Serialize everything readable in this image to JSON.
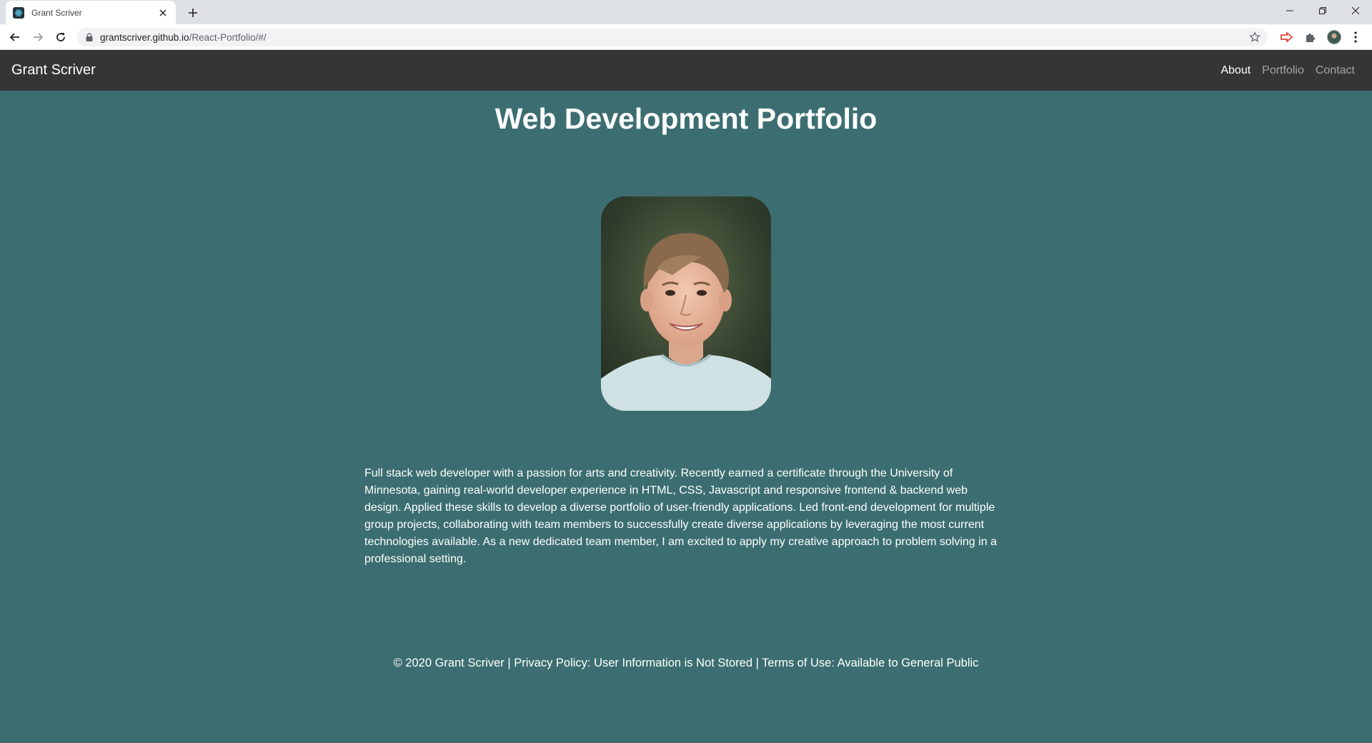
{
  "browser": {
    "tab_title": "Grant Scriver",
    "url_host": "grantscriver.github.io",
    "url_path": "/React-Portfolio/#/"
  },
  "site": {
    "brand": "Grant Scriver",
    "nav": [
      {
        "label": "About",
        "active": true
      },
      {
        "label": "Portfolio",
        "active": false
      },
      {
        "label": "Contact",
        "active": false
      }
    ],
    "title": "Web Development Portfolio",
    "bio": "Full stack web developer with a passion for arts and creativity. Recently earned a certificate through the University of Minnesota, gaining real-world developer experience in HTML, CSS, Javascript and responsive frontend & backend web design. Applied these skills to develop a diverse portfolio of user-friendly applications. Led front-end development for multiple group projects, collaborating with team members to successfully create diverse applications by leveraging the most current technologies available. As a new dedicated team member, I am excited to apply my creative approach to problem solving in a professional setting.",
    "footer": "© 2020 Grant Scriver | Privacy Policy: User Information is Not Stored | Terms of Use: Available to General Public"
  },
  "colors": {
    "navbar": "#353535",
    "background": "#3c6e71"
  }
}
